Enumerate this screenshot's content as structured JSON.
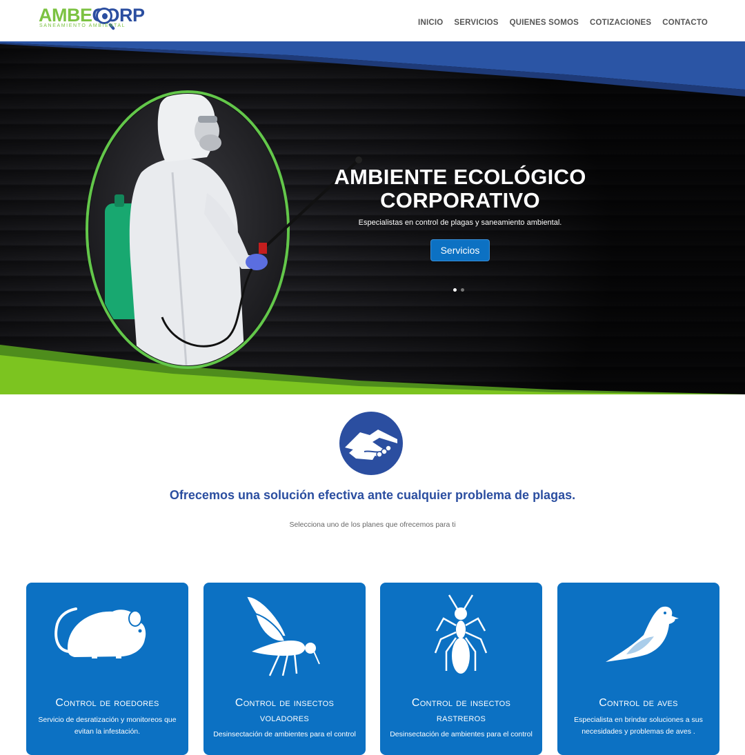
{
  "header": {
    "logo": {
      "part1": "AMBE",
      "part2": "CORP",
      "tagline": "Saneamiento ambiental"
    },
    "nav": [
      "INICIO",
      "SERVICIOS",
      "QUIENES SOMOS",
      "COTIZACIONES",
      "CONTACTO"
    ]
  },
  "hero": {
    "title_line1": "AMBIENTE ECOLÓGICO",
    "title_line2": "CORPORATIVO",
    "subtitle": "Especialistas en control de plagas y saneamiento ambiental.",
    "button_label": "Servicios",
    "active_slide": 1,
    "slide_count": 2
  },
  "intro": {
    "icon": "handshake-icon",
    "title": "Ofrecemos una solución efectiva ante cualquier problema de plagas.",
    "subtitle": "Selecciona uno de los planes que ofrecemos para ti"
  },
  "cards": [
    {
      "icon": "mouse-icon",
      "title": "Control de roedores",
      "description": "Servicio de desratización y monitoreos que evitan la infestación."
    },
    {
      "icon": "mosquito-icon",
      "title": "Control de insectos voladores",
      "description": "Desinsectación de ambientes para el control"
    },
    {
      "icon": "ant-icon",
      "title": "Control de insectos rastreros",
      "description": "Desinsectación de ambientes para el control"
    },
    {
      "icon": "bird-icon",
      "title": "Control de aves",
      "description": "Especialista en brindar soluciones a sus necesidades y problemas de aves ."
    }
  ],
  "colors": {
    "brand_blue": "#2b4ea0",
    "card_blue": "#0c71c3",
    "brand_green": "#7cc242",
    "nav_text": "#555555"
  }
}
